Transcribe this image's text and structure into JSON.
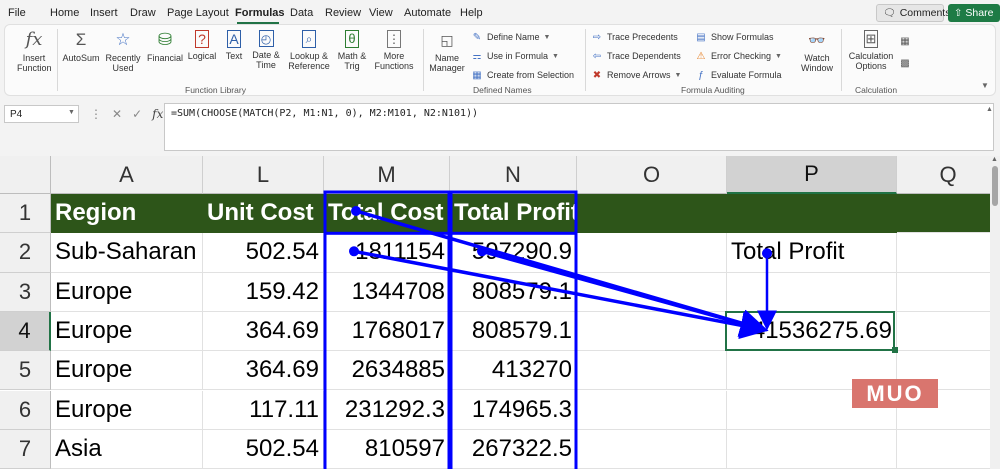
{
  "menu": {
    "tabs": [
      "File",
      "Home",
      "Insert",
      "Draw",
      "Page Layout",
      "Formulas",
      "Data",
      "Review",
      "View",
      "Automate",
      "Help"
    ],
    "active_tab": "Formulas",
    "comments_label": "Comments",
    "share_label": "Share"
  },
  "ribbon": {
    "function_library": {
      "label": "Function Library",
      "buttons": [
        {
          "label": "Insert Function",
          "icon": "fx-icon"
        },
        {
          "label": "AutoSum",
          "icon": "sigma-icon"
        },
        {
          "label": "Recently Used",
          "icon": "star-icon"
        },
        {
          "label": "Financial",
          "icon": "coins-icon"
        },
        {
          "label": "Logical",
          "icon": "question-book-icon"
        },
        {
          "label": "Text",
          "icon": "text-book-icon"
        },
        {
          "label": "Date & Time",
          "icon": "calendar-icon"
        },
        {
          "label": "Lookup & Reference",
          "icon": "search-book-icon"
        },
        {
          "label": "Math & Trig",
          "icon": "theta-icon"
        },
        {
          "label": "More Functions",
          "icon": "more-functions-icon"
        }
      ]
    },
    "defined_names": {
      "label": "Defined Names",
      "name_manager": "Name Manager",
      "items": [
        "Define Name",
        "Use in Formula",
        "Create from Selection"
      ]
    },
    "formula_auditing": {
      "label": "Formula Auditing",
      "items": [
        "Trace Precedents",
        "Trace Dependents",
        "Remove Arrows",
        "Show Formulas",
        "Error Checking",
        "Evaluate Formula"
      ],
      "watch_window": "Watch Window"
    },
    "calculation": {
      "label": "Calculation",
      "options": "Calculation Options"
    }
  },
  "formula_bar": {
    "name_box": "P4",
    "formula": "=SUM(CHOOSE(MATCH(P2, M1:N1, 0), M2:M101, N2:N101))"
  },
  "sheet": {
    "columns": [
      "A",
      "L",
      "M",
      "N",
      "O",
      "P",
      "Q"
    ],
    "rows": [
      "1",
      "2",
      "3",
      "4",
      "5",
      "6",
      "7"
    ],
    "header_row": [
      "Region",
      "Unit Cost",
      "Total Cost",
      "Total Profit"
    ],
    "data": [
      [
        "Sub-Saharan",
        "502.54",
        "1811154",
        "597290.9"
      ],
      [
        "Europe",
        "159.42",
        "1344708",
        "808579.1"
      ],
      [
        "Europe",
        "364.69",
        "1768017",
        "808579.1"
      ],
      [
        "Europe",
        "364.69",
        "2634885",
        "413270"
      ],
      [
        "Europe",
        "117.11",
        "231292.3",
        "174965.3"
      ],
      [
        "Asia",
        "502.54",
        "810597",
        "267322.5"
      ]
    ],
    "p2_label": "Total Profit",
    "p4_value": "41536275.69",
    "selected_cell": "P4",
    "header_fill": "#2d5519",
    "trace_color": "#0000ff"
  },
  "watermark": "MUO"
}
